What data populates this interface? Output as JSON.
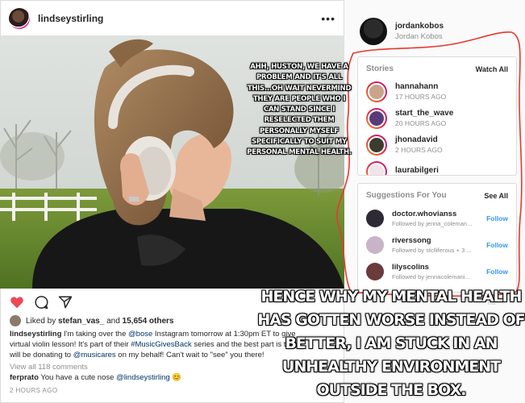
{
  "post": {
    "username": "lindseystirling",
    "more_icon": "more-horizontal-icon",
    "liked_by": {
      "prefix": "Liked by",
      "user": "stefan_vas_",
      "middle": "and",
      "count": "15,654 others"
    },
    "caption": {
      "user": "lindseystirling",
      "line1_a": "I'm taking over the",
      "line1_mention": "@bose",
      "line1_b": "Instagram tomorrow at 1:30pm ET to give",
      "line2_a": "virtual violin lesson! It's part of their",
      "line2_hashtag": "#MusicGivesBack",
      "line2_b": "series and the best part is tha",
      "line3_a": "will be donating to",
      "line3_mention": "@musicares",
      "line3_b": "on my behalf! Can't wait to \"see\" you there!"
    },
    "view_comments": "View all 118 comments",
    "comment": {
      "user": "ferprato",
      "text": "You have a cute nose",
      "mention": "@lindseystirling",
      "emoji": "😊"
    },
    "timestamp": "2 HOURS AGO"
  },
  "sidebar": {
    "username": "jordankobos",
    "full_name": "Jordan Kobos"
  },
  "stories": {
    "title": "Stories",
    "action": "Watch All",
    "items": [
      {
        "name": "hannahann",
        "time": "17 HOURS AGO"
      },
      {
        "name": "start_the_wave",
        "time": "20 HOURS AGO"
      },
      {
        "name": "jhonadavid",
        "time": "2 HOURS AGO"
      },
      {
        "name": "laurabilgeri",
        "time": ""
      }
    ]
  },
  "suggestions": {
    "title": "Suggestions For You",
    "action": "See All",
    "follow_label": "Follow",
    "items": [
      {
        "name": "doctor.whovianss",
        "sub": "Followed by jenna_coleman..."
      },
      {
        "name": "riverssong",
        "sub": "Followed by stclliferous + 3 ..."
      },
      {
        "name": "lilyscolins",
        "sub": "Followed by jennacolemani..."
      }
    ]
  },
  "faint_text": "ms",
  "meme": {
    "top_text": "AHH, HUSTON, WE HAVE A PROBLEM AND IT'S ALL THIS...OH WAIT NEVERMIND THEY ARE PEOPLE WHO I CAN STAND SINCE I RESELECTED THEM PERSONALLY MYSELF SPECIFICALLY TO SUIT MY PERSONAL MENTAL HEALTH.",
    "bottom_text": "HENCE WHY MY MENTAL HEALTH HAS GOTTEN WORSE INSTEAD OF BETTER, I AM STUCK IN AN UNHEALTHY ENVIRONMENT OUTSIDE THE BOX."
  },
  "colors": {
    "link_blue": "#3897f0",
    "heart_red": "#ed4956",
    "outline_red": "#e8382f"
  }
}
